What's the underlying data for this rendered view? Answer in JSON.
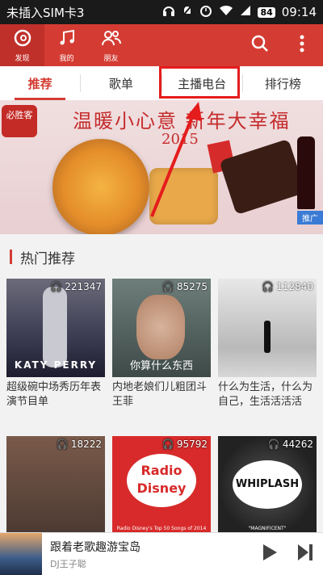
{
  "status_bar": {
    "carrier": "未插入SIM卡3",
    "battery": "84",
    "time": "09:14"
  },
  "top_nav": {
    "items": [
      {
        "label": "发现",
        "icon": "netease-music-icon",
        "active": true
      },
      {
        "label": "我的",
        "icon": "music-note-icon",
        "active": false
      },
      {
        "label": "朋友",
        "icon": "friends-icon",
        "active": false
      }
    ]
  },
  "tabs": [
    {
      "label": "推荐",
      "active": true
    },
    {
      "label": "歌单",
      "active": false
    },
    {
      "label": "主播电台",
      "active": false
    },
    {
      "label": "排行榜",
      "active": false
    }
  ],
  "banner": {
    "title": "温暖小心意 新年大幸福",
    "year": "2015",
    "logo_text": "必胜客",
    "ad_tag": "推广"
  },
  "section": {
    "title": "热门推荐"
  },
  "playlists": [
    {
      "count": "221347",
      "title": "超级碗中场秀历年表演节目单",
      "cover_text": "KATY PERRY"
    },
    {
      "count": "85275",
      "title": "内地老娘们儿粗团斗王菲",
      "cover_text": "你算什么东西"
    },
    {
      "count": "112840",
      "title": "什么为生活，什么为自己，生活活活活",
      "cover_text": ""
    },
    {
      "count": "18222",
      "title": "",
      "cover_text": ""
    },
    {
      "count": "95792",
      "title": "",
      "cover_text": "Radio Disney"
    },
    {
      "count": "44262",
      "title": "",
      "cover_text": "WHIPLASH"
    }
  ],
  "radio_caption": "Radio Disney's Top 50 Songs of 2014",
  "whiplash_caption": "\"MAGNIFICENT\"",
  "player": {
    "title": "跟着老歌趣游宝岛",
    "artist": "DJ王子聪"
  },
  "colors": {
    "accent": "#d43c33",
    "highlight_box": "#e51c1c",
    "arrow": "#e51c1c"
  }
}
